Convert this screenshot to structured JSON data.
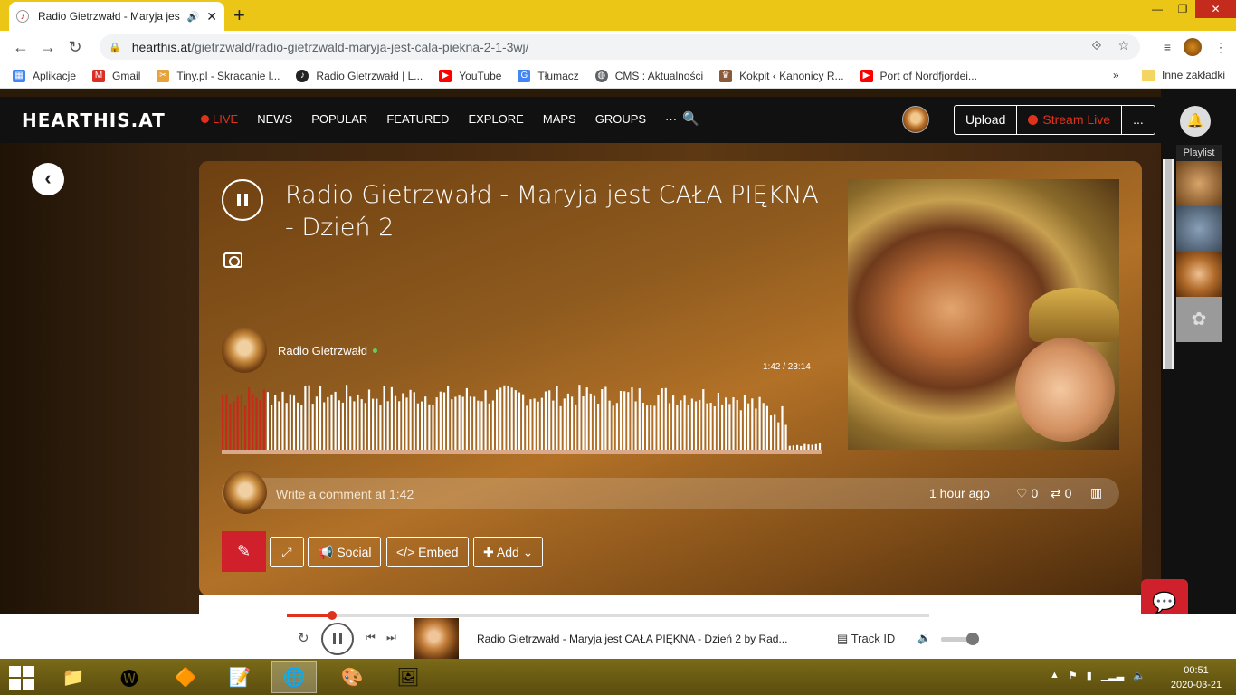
{
  "browser": {
    "tab_title": "Radio Gietrzwałd - Maryja jes",
    "url_host": "hearthis.at",
    "url_path": "/gietrzwald/radio-gietrzwald-maryja-jest-cala-piekna-2-1-3wj/",
    "bookmarks": [
      {
        "label": "Aplikacje",
        "icon": "apps-grid-icon",
        "color": "#4285f4"
      },
      {
        "label": "Gmail",
        "icon": "gmail-icon",
        "color": "#d93025"
      },
      {
        "label": "Tiny.pl - Skracanie l...",
        "icon": "scissors-icon",
        "color": "#e6a23c"
      },
      {
        "label": "Radio Gietrzwałd | L...",
        "icon": "hearthis-icon",
        "color": "#222222"
      },
      {
        "label": "YouTube",
        "icon": "youtube-icon",
        "color": "#ff0000"
      },
      {
        "label": "Tłumacz",
        "icon": "translate-icon",
        "color": "#4285f4"
      },
      {
        "label": "CMS : Aktualności",
        "icon": "globe-icon",
        "color": "#5f6368"
      },
      {
        "label": "Kokpit ‹ Kanonicy R...",
        "icon": "crest-icon",
        "color": "#8a5a3a"
      },
      {
        "label": "Port of Nordfjordei...",
        "icon": "youtube-icon",
        "color": "#ff0000"
      }
    ],
    "bookmarks_more": "»",
    "other_bookmarks": "Inne zakładki"
  },
  "site": {
    "logo": "HEARTHIS.AT",
    "nav": [
      "LIVE",
      "NEWS",
      "POPULAR",
      "FEATURED",
      "EXPLORE",
      "MAPS",
      "GROUPS",
      "···"
    ],
    "upload": "Upload",
    "stream_live": "Stream Live",
    "more": "..."
  },
  "track": {
    "title": "Radio Gietrzwałd - Maryja jest CAŁA PIĘKNA - Dzień 2",
    "artist": "Radio Gietrzwałd",
    "time_current": "1:42",
    "time_total": "23:14",
    "time_display": "1:42 / 23:14",
    "progress_fraction": 0.073,
    "comment_placeholder": "Write a comment at 1:42",
    "posted": "1 hour ago",
    "likes": "0",
    "reposts": "0"
  },
  "actions": {
    "social": "Social",
    "embed": "Embed",
    "add": "Add"
  },
  "playlist": {
    "label": "Playlist"
  },
  "player": {
    "now_playing": "Radio Gietrzwałd - Maryja jest CAŁA PIĘKNA - Dzień 2 by Rad...",
    "track_id": "Track ID",
    "volume_fraction": 0.8
  },
  "taskbar": {
    "time": "00:51",
    "date": "2020-03-21"
  },
  "colors": {
    "accent": "#e0321b",
    "button_red": "#d0202c",
    "browser_frame": "#ebc616"
  }
}
